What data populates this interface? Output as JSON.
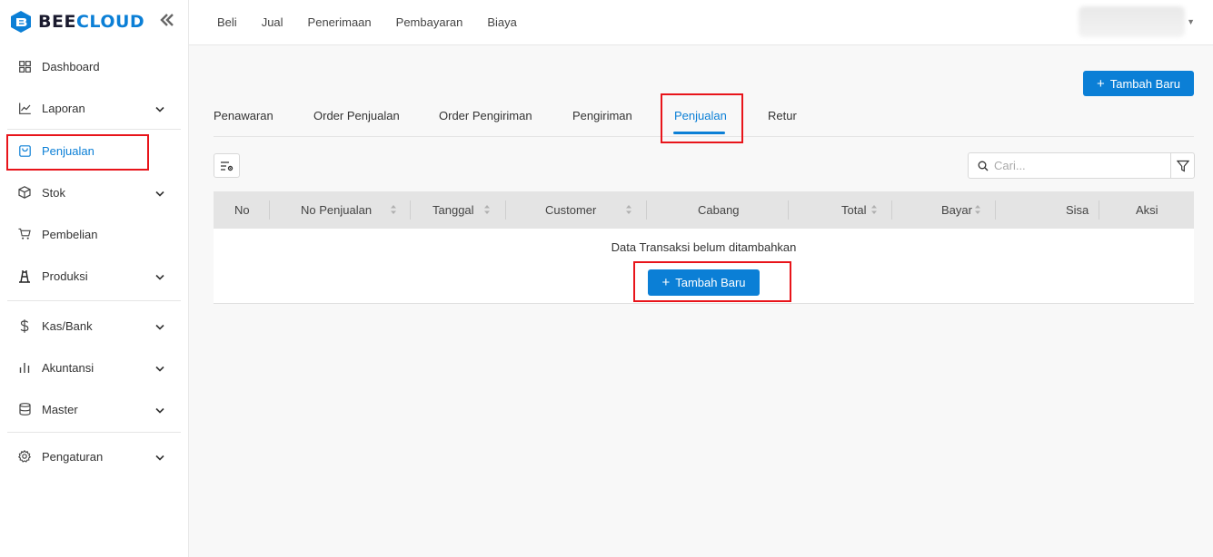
{
  "app": {
    "logo_bee": "BEE",
    "logo_cloud": "CLOUD",
    "brand_color": "#0b7fd6",
    "highlight_color": "#e8141a"
  },
  "sidebar": {
    "items": [
      {
        "label": "Dashboard",
        "icon": "dashboard-icon"
      },
      {
        "label": "Laporan",
        "icon": "chart-line-icon"
      },
      {
        "label": "Penjualan",
        "icon": "shopping-bag-icon",
        "active": true
      },
      {
        "label": "Stok",
        "icon": "box-icon"
      },
      {
        "label": "Pembelian",
        "icon": "cart-icon"
      },
      {
        "label": "Produksi",
        "icon": "factory-icon"
      },
      {
        "label": "Kas/Bank",
        "icon": "dollar-icon"
      },
      {
        "label": "Akuntansi",
        "icon": "bar-chart-icon"
      },
      {
        "label": "Master",
        "icon": "database-icon"
      },
      {
        "label": "Pengaturan",
        "icon": "gear-icon"
      }
    ]
  },
  "topnav": {
    "items": [
      "Beli",
      "Jual",
      "Penerimaan",
      "Pembayaran",
      "Biaya"
    ]
  },
  "main": {
    "add_button_label": "Tambah Baru",
    "tabs": [
      {
        "label": "Penawaran"
      },
      {
        "label": "Order Penjualan"
      },
      {
        "label": "Order Pengiriman"
      },
      {
        "label": "Pengiriman"
      },
      {
        "label": "Penjualan",
        "active": true
      },
      {
        "label": "Retur"
      }
    ],
    "search": {
      "placeholder": "Cari..."
    },
    "table": {
      "columns": [
        "No",
        "No Penjualan",
        "Tanggal",
        "Customer",
        "Cabang",
        "Total",
        "Bayar",
        "Sisa",
        "Aksi"
      ],
      "empty_text": "Data Transaksi belum ditambahkan",
      "empty_add_label": "Tambah Baru"
    }
  }
}
